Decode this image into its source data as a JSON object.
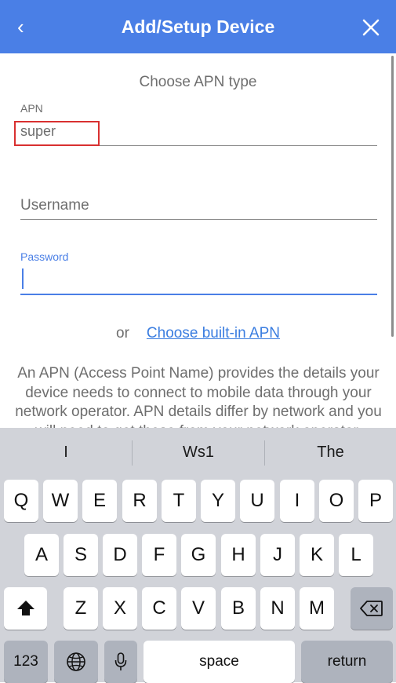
{
  "header": {
    "title": "Add/Setup Device",
    "back_glyph": "‹",
    "bg_color": "#4a7fe6"
  },
  "form": {
    "subtitle": "Choose APN type",
    "apn": {
      "label": "APN",
      "value": "super"
    },
    "username": {
      "placeholder": "Username"
    },
    "password": {
      "label": "Password",
      "value": ""
    },
    "or_text": "or",
    "builtin_link": "Choose built-in APN",
    "description": "An APN (Access Point Name) provides the details your device needs to connect to mobile data through your network operator. APN details differ by network and you will need to get these from your network operator."
  },
  "keyboard": {
    "suggestions": [
      "I",
      "Ws1",
      "The"
    ],
    "row1": [
      "Q",
      "W",
      "E",
      "R",
      "T",
      "Y",
      "U",
      "I",
      "O",
      "P"
    ],
    "row2": [
      "A",
      "S",
      "D",
      "F",
      "G",
      "H",
      "J",
      "K",
      "L"
    ],
    "row3": [
      "Z",
      "X",
      "C",
      "V",
      "B",
      "N",
      "M"
    ],
    "numbers_label": "123",
    "space_label": "space",
    "return_label": "return"
  }
}
